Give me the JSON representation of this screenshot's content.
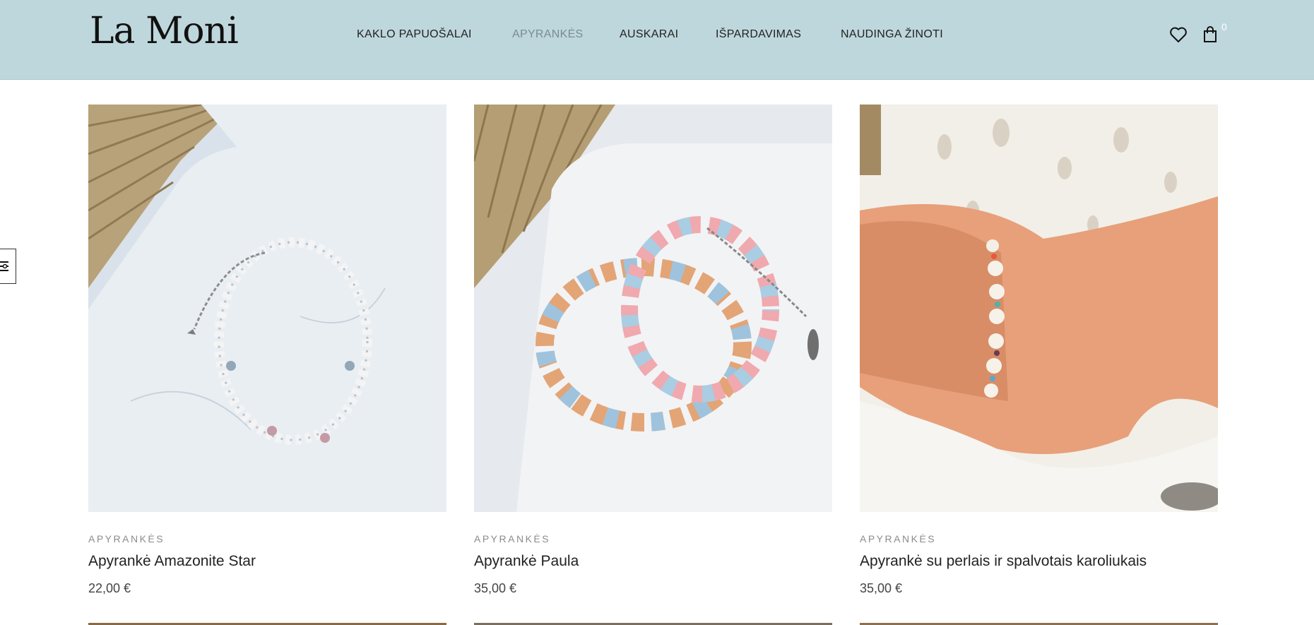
{
  "header": {
    "logo": "La Moni",
    "nav": [
      {
        "label": "KAKLO PAPUOŠALAI",
        "active": false
      },
      {
        "label": "APYRANKĖS",
        "active": true
      },
      {
        "label": "AUSKARAI",
        "active": false
      },
      {
        "label": "IŠPARDAVIMAS",
        "active": false
      },
      {
        "label": "NAUDINGA ŽINOTI",
        "active": false
      }
    ],
    "wishlist_icon": "heart-icon",
    "cart_icon": "shopping-bag-icon",
    "cart_count": "0"
  },
  "side_tab_icon": "filter-icon",
  "products": [
    {
      "category": "APYRANKĖS",
      "title": "Apyrankė Amazonite Star",
      "price": "22,00 €"
    },
    {
      "category": "APYRANKĖS",
      "title": "Apyrankė Paula",
      "price": "35,00 €"
    },
    {
      "category": "APYRANKĖS",
      "title": "Apyrankė su perlais ir spalvotais karoliukais",
      "price": "35,00 €"
    }
  ],
  "colors": {
    "header_bg": "#bed7dc",
    "nav_active": "#7a8d92",
    "text": "#222222",
    "category": "#8c8c8c"
  }
}
